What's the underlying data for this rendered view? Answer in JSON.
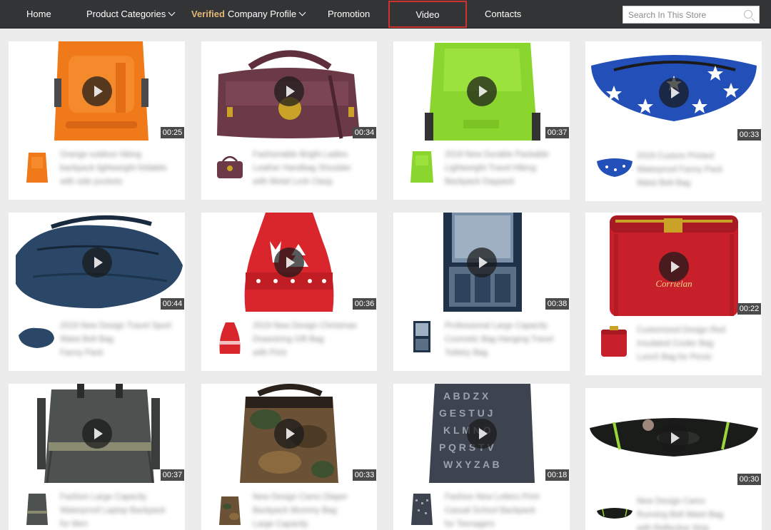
{
  "nav": {
    "home": "Home",
    "product_categories": "Product Categories",
    "verified": "Verified",
    "company_profile": "Company Profile",
    "promotion": "Promotion",
    "video": "Video",
    "contacts": "Contacts"
  },
  "search": {
    "placeholder": "Search In This Store"
  },
  "videos": [
    {
      "duration": "00:25",
      "title": [
        "Orange outdoor hiking",
        "backpack lightweight foldable",
        "with side pockets"
      ]
    },
    {
      "duration": "00:34",
      "title": [
        "Fashionable Bright Ladies",
        "Leather Handbag Shoulder",
        "with Metal Lock Clasp"
      ]
    },
    {
      "duration": "00:37",
      "title": [
        "2019 New Durable Packable",
        "Lightweight Travel Hiking",
        "Backpack Daypack"
      ]
    },
    {
      "duration": "00:33",
      "title": [
        "2019 Custom Printed",
        "Waterproof Fanny Pack",
        "Waist Belt Bag"
      ]
    },
    {
      "duration": "00:44",
      "title": [
        "2019 New Design Travel Sport",
        "Waist Belt Bag",
        "Fanny Pack"
      ]
    },
    {
      "duration": "00:36",
      "title": [
        "2019 New Design Christmas",
        "Drawstring Gift Bag",
        "with Print"
      ]
    },
    {
      "duration": "00:38",
      "title": [
        "Professional Large Capacity",
        "Cosmetic Bag Hanging Travel",
        "Toiletry Bag"
      ]
    },
    {
      "duration": "00:22",
      "title": [
        "Customized Design Red",
        "Insulated Cooler Bag",
        "Lunch Bag for Picnic"
      ]
    },
    {
      "duration": "00:37",
      "title": [
        "Fashion Large Capacity",
        "Waterproof Laptop Backpack",
        "for Men"
      ]
    },
    {
      "duration": "00:33",
      "title": [
        "New Design Camo Diaper",
        "Backpack Mommy Bag",
        "Large Capacity"
      ]
    },
    {
      "duration": "00:18",
      "title": [
        "Fashion New Letters Print",
        "Casual School Backpack",
        "for Teenagers"
      ]
    },
    {
      "duration": "00:30",
      "title": [
        "New Design Camo",
        "Running Belt Waist Bag",
        "with Reflective Strip"
      ]
    }
  ],
  "colors": {
    "nav_bg": "#333436",
    "verified": "#e3b776",
    "active_outline": "#d0312d",
    "page_bg": "#ececec"
  }
}
